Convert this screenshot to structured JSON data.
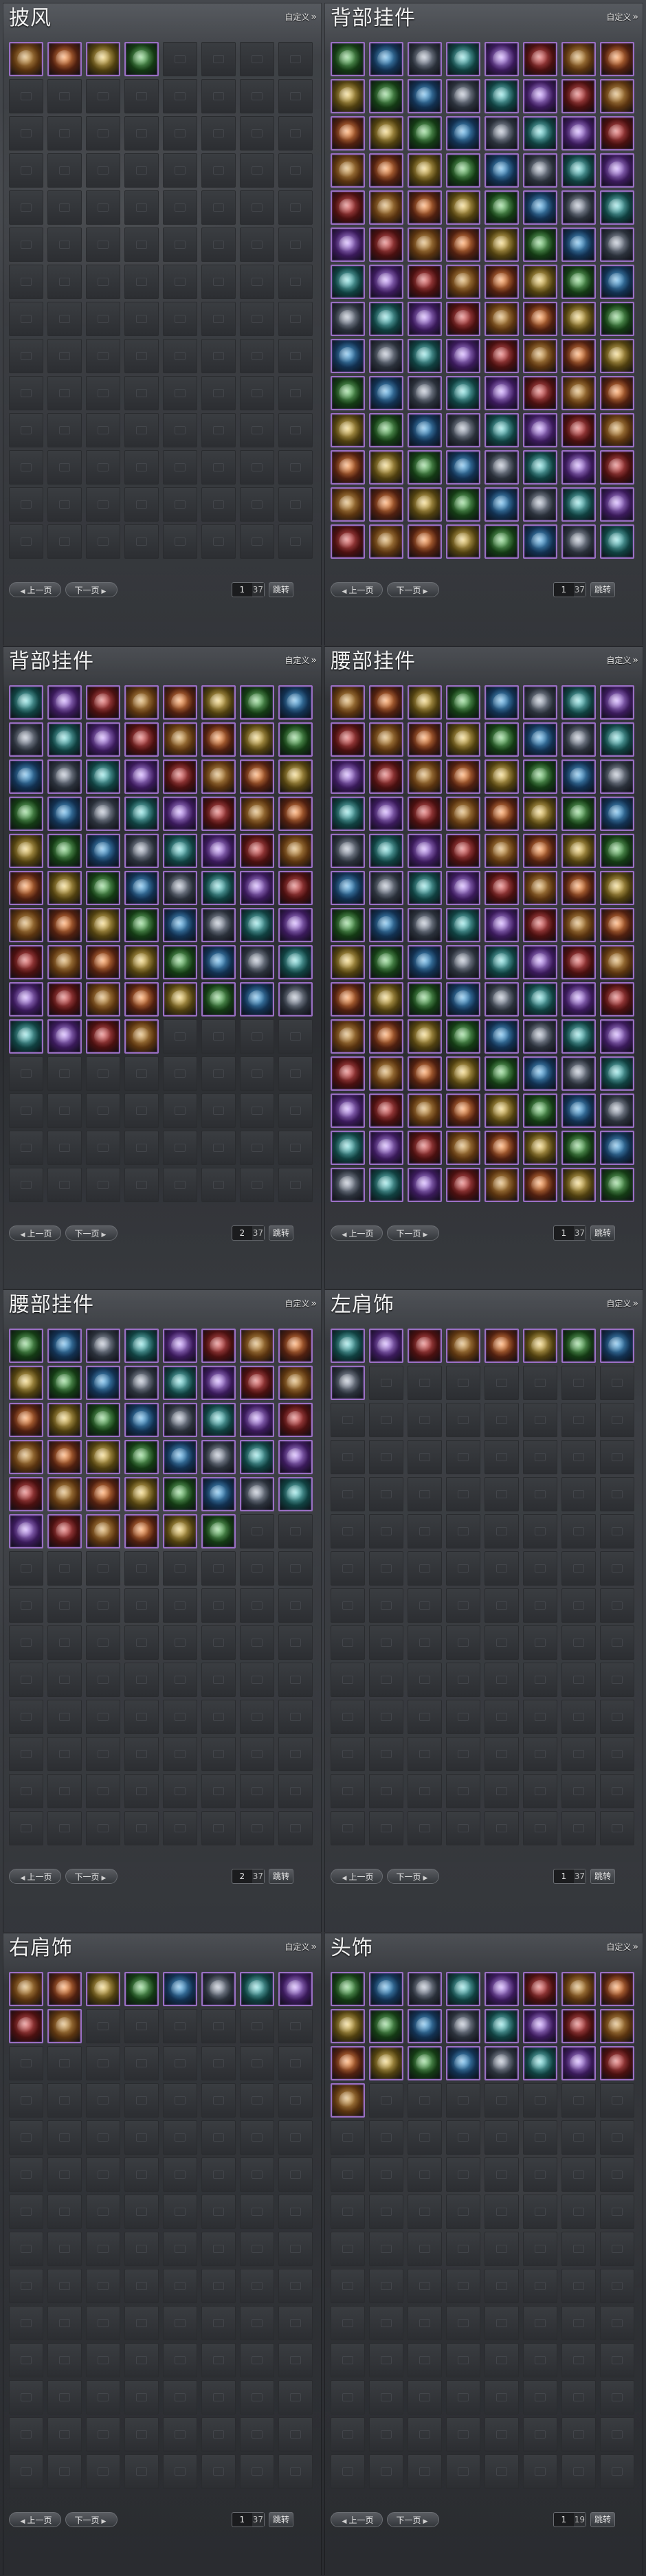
{
  "customize_label": "自定义",
  "pager_labels": {
    "prev": "上一页",
    "next": "下一页",
    "jump": "跳转"
  },
  "panels": [
    {
      "title": "披风",
      "filled": 4,
      "page": "1",
      "total": "37"
    },
    {
      "title": "背部挂件",
      "filled": 112,
      "page": "1",
      "total": "37"
    },
    {
      "title": "背部挂件",
      "filled": 76,
      "page": "2",
      "total": "37"
    },
    {
      "title": "腰部挂件",
      "filled": 112,
      "page": "1",
      "total": "37"
    },
    {
      "title": "腰部挂件",
      "filled": 46,
      "page": "2",
      "total": "37"
    },
    {
      "title": "左肩饰",
      "filled": 9,
      "page": "1",
      "total": "37"
    },
    {
      "title": "右肩饰",
      "filled": 10,
      "page": "1",
      "total": "37"
    },
    {
      "title": "头饰",
      "filled": 25,
      "page": "1",
      "total": "19"
    }
  ],
  "colors": {
    "item_border": "#9a6fc4",
    "empty_slot": "#34373b"
  }
}
